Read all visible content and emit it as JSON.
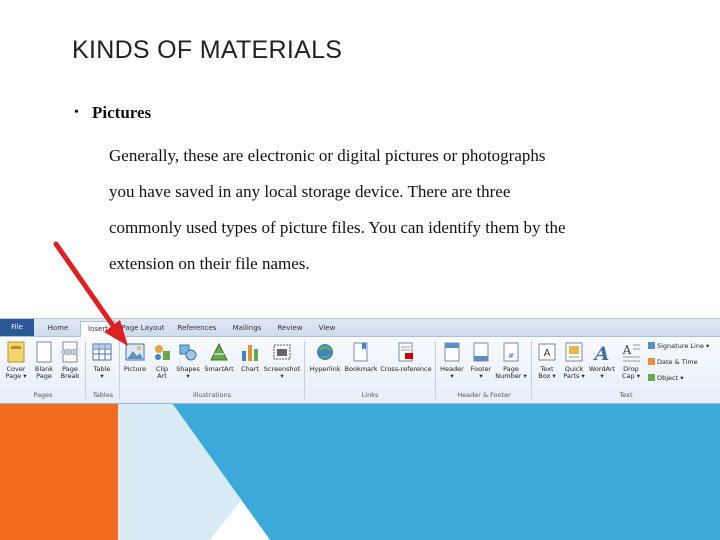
{
  "slide": {
    "title": "KINDS OF MATERIALS",
    "bullet_symbol": "•",
    "bullet_heading": "Pictures",
    "paragraph_lines": [
      "Generally, these are electronic or digital pictures or photographs",
      "you have saved in any local storage device. There are three",
      "commonly used types of picture files. You can identify them by the",
      "extension on their file names."
    ]
  },
  "ribbon": {
    "tabs": {
      "file": "File",
      "home": "Home",
      "insert": "Insert",
      "page_layout": "Page Layout",
      "references": "References",
      "mailings": "Mailings",
      "review": "Review",
      "view": "View"
    },
    "buttons": {
      "cover_page": [
        "Cover",
        "Page ▾"
      ],
      "blank_page": [
        "Blank",
        "Page"
      ],
      "page_break": [
        "Page",
        "Break"
      ],
      "table": [
        "Table",
        "▾"
      ],
      "picture": [
        "Picture",
        ""
      ],
      "clip_art": [
        "Clip",
        "Art"
      ],
      "shapes": [
        "Shapes",
        "▾"
      ],
      "smartart": [
        "SmartArt",
        ""
      ],
      "chart": [
        "Chart",
        ""
      ],
      "screenshot": [
        "Screenshot",
        "▾"
      ],
      "hyperlink": [
        "Hyperlink",
        ""
      ],
      "bookmark": [
        "Bookmark",
        ""
      ],
      "cross_reference": [
        "Cross-reference",
        ""
      ],
      "header": [
        "Header",
        "▾"
      ],
      "footer": [
        "Footer",
        "▾"
      ],
      "page_number": [
        "Page",
        "Number ▾"
      ],
      "text_box": [
        "Text",
        "Box ▾"
      ],
      "quick_parts": [
        "Quick",
        "Parts ▾"
      ],
      "wordart": [
        "WordArt",
        "▾"
      ],
      "drop_cap": [
        "Drop",
        "Cap ▾"
      ]
    },
    "small_items": {
      "signature_line": "Signature Line ▾",
      "date_time": "Date & Time",
      "object": "Object ▾"
    },
    "groups": {
      "pages": "Pages",
      "tables": "Tables",
      "illustrations": "Illustrations",
      "links": "Links",
      "header_footer": "Header & Footer",
      "text": "Text"
    }
  },
  "colors": {
    "orange": "#f26b21",
    "blue": "#3ca9db",
    "light_blue": "#d9ecf6",
    "arrow_red": "#e02020"
  }
}
